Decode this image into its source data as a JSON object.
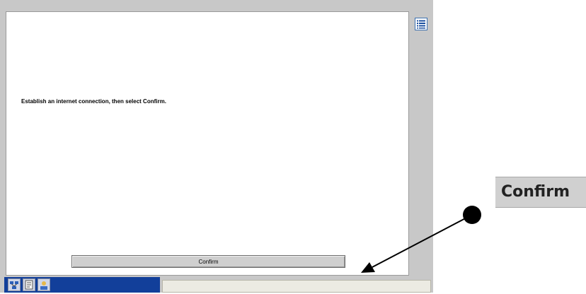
{
  "dialog": {
    "message": "Establish an internet connection, then select Confirm.",
    "confirm_label": "Confirm"
  },
  "taskbar": {
    "icons": [
      "network-icon",
      "document-icon",
      "user-icon"
    ]
  },
  "callout": {
    "zoom_label": "Confirm"
  },
  "colors": {
    "frame": "#c8c8c8",
    "taskbar": "#123f9a",
    "button": "#cfcfcf",
    "menu_icon": "#1a4fa0"
  }
}
